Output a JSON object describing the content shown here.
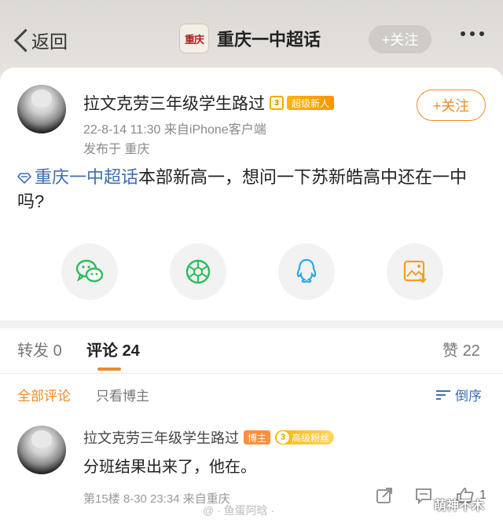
{
  "nav": {
    "back_label": "返回",
    "topic_logo_text": "重庆",
    "title": "重庆一中超话",
    "follow_label": "+关注"
  },
  "post": {
    "username": "拉文克劳三年级学生路过",
    "level_text": "3",
    "badge": "超级新人",
    "datetime_source": "22-8-14 11:30  来自iPhone客户端",
    "location": "发布于 重庆",
    "follow_label": "+关注",
    "topic_link": "重庆一中超话",
    "body": "本部新高一，想问一下苏新皓高中还在一中吗?"
  },
  "share": {
    "icons": [
      "wechat-icon",
      "moments-icon",
      "qq-icon",
      "save-image-icon"
    ]
  },
  "tabs": {
    "repost_label": "转发",
    "repost_count": "0",
    "comments_label": "评论",
    "comments_count": "24",
    "likes_label": "赞",
    "likes_count": "22"
  },
  "filter": {
    "all_label": "全部评论",
    "op_only_label": "只看博主",
    "sort_label": "倒序"
  },
  "comment": {
    "username": "拉文克劳三年级学生路过",
    "tag_op": "博主",
    "fan_level": "3",
    "fan_label": "高级粉丝",
    "text": "分班结果出来了，他在。",
    "meta": "第15楼  8-30 23:34  来自重庆",
    "like_count": "1"
  },
  "watermarks": {
    "left": "@ · 鱼蛋阿晗 ·",
    "right": "萌神不木"
  },
  "colors": {
    "accent": "#f08a24",
    "link": "#3e6fb0",
    "wechat": "#2cbd5a",
    "qq": "#29a9f0"
  }
}
